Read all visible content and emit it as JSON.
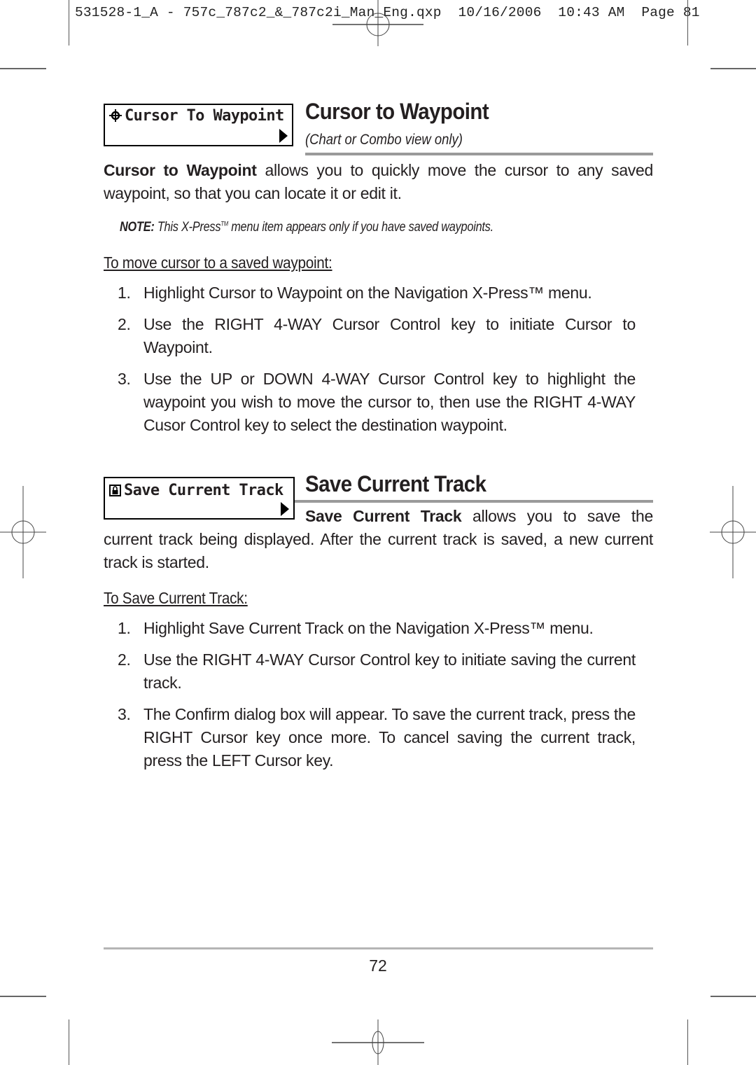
{
  "slug": {
    "text": "531528-1_A - 757c_787c2_&_787c2i_Man_Eng.qxp  10/16/2006  10:43 AM  Page 81"
  },
  "sections": {
    "cursor_to_waypoint": {
      "menu_label": "Cursor To Waypoint",
      "menu_icon": "crosshair-icon",
      "title": "Cursor to Waypoint",
      "subtitle": "(Chart or Combo view only)",
      "intro_bold": "Cursor to Waypoint",
      "intro_rest": " allows you to quickly move the cursor to any saved waypoint, so that you can locate it or edit it.",
      "note_label": "NOTE:",
      "note_text_a": " This X-Press",
      "note_tm": "TM",
      "note_text_b": " menu item appears only if you have saved waypoints.",
      "procedure_title": "To move cursor to a saved waypoint:",
      "steps": [
        {
          "num": "1.",
          "text": "Highlight Cursor to Waypoint on the Navigation X-Press™ menu."
        },
        {
          "num": "2.",
          "text": "Use the RIGHT 4-WAY Cursor Control key to initiate Cursor to Waypoint."
        },
        {
          "num": "3.",
          "text": "Use the UP or DOWN 4-WAY Cursor Control key to highlight the waypoint you wish to move the cursor to, then use the RIGHT 4-WAY Cusor Control key to select the destination waypoint."
        }
      ]
    },
    "save_current_track": {
      "menu_label": "Save Current Track",
      "menu_icon": "save-lock-icon",
      "title": "Save Current Track",
      "intro_bold": "Save Current Track",
      "intro_rest": " allows you to save the current track being displayed. After the current track is saved, a new current track is started.",
      "procedure_title": "To Save Current Track:",
      "steps": [
        {
          "num": "1.",
          "text": "Highlight Save Current Track on the Navigation X-Press™ menu."
        },
        {
          "num": "2.",
          "text": "Use the RIGHT 4-WAY Cursor Control key to initiate saving the current track."
        },
        {
          "num": "3.",
          "text": "The Confirm dialog box will appear. To save the current track, press the RIGHT Cursor key once more. To cancel saving the current track, press the LEFT Cursor key."
        }
      ]
    }
  },
  "footer": {
    "page_number": "72"
  }
}
